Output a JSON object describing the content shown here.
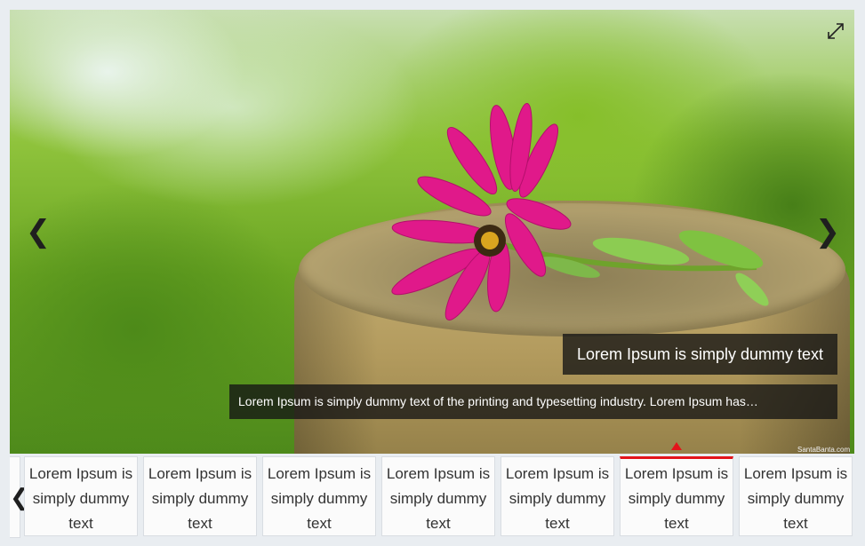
{
  "slider": {
    "image_description_icon": "flower-photo",
    "prev_icon": "chevron-left-icon",
    "next_icon": "chevron-right-icon",
    "prev_glyph": "❮",
    "next_glyph": "❯",
    "fullscreen_icon": "fullscreen-icon",
    "caption_title": "Lorem Ipsum is simply dummy text",
    "caption_description": "Lorem Ipsum is simply dummy text of the printing and typesetting industry. Lorem Ipsum has…",
    "watermark": "SantaBanta.com"
  },
  "thumbnails": {
    "prev_glyph": "❮",
    "accent_color": "#e3141b",
    "active_index": 5,
    "items": [
      {
        "label": "Lorem Ipsum is simply dummy text"
      },
      {
        "label": "Lorem Ipsum is simply dummy text"
      },
      {
        "label": "Lorem Ipsum is simply dummy text"
      },
      {
        "label": "Lorem Ipsum is simply dummy text"
      },
      {
        "label": "Lorem Ipsum is simply dummy text"
      },
      {
        "label": "Lorem Ipsum is simply dummy text"
      },
      {
        "label": "Lorem Ipsum is simply dummy text"
      }
    ]
  }
}
